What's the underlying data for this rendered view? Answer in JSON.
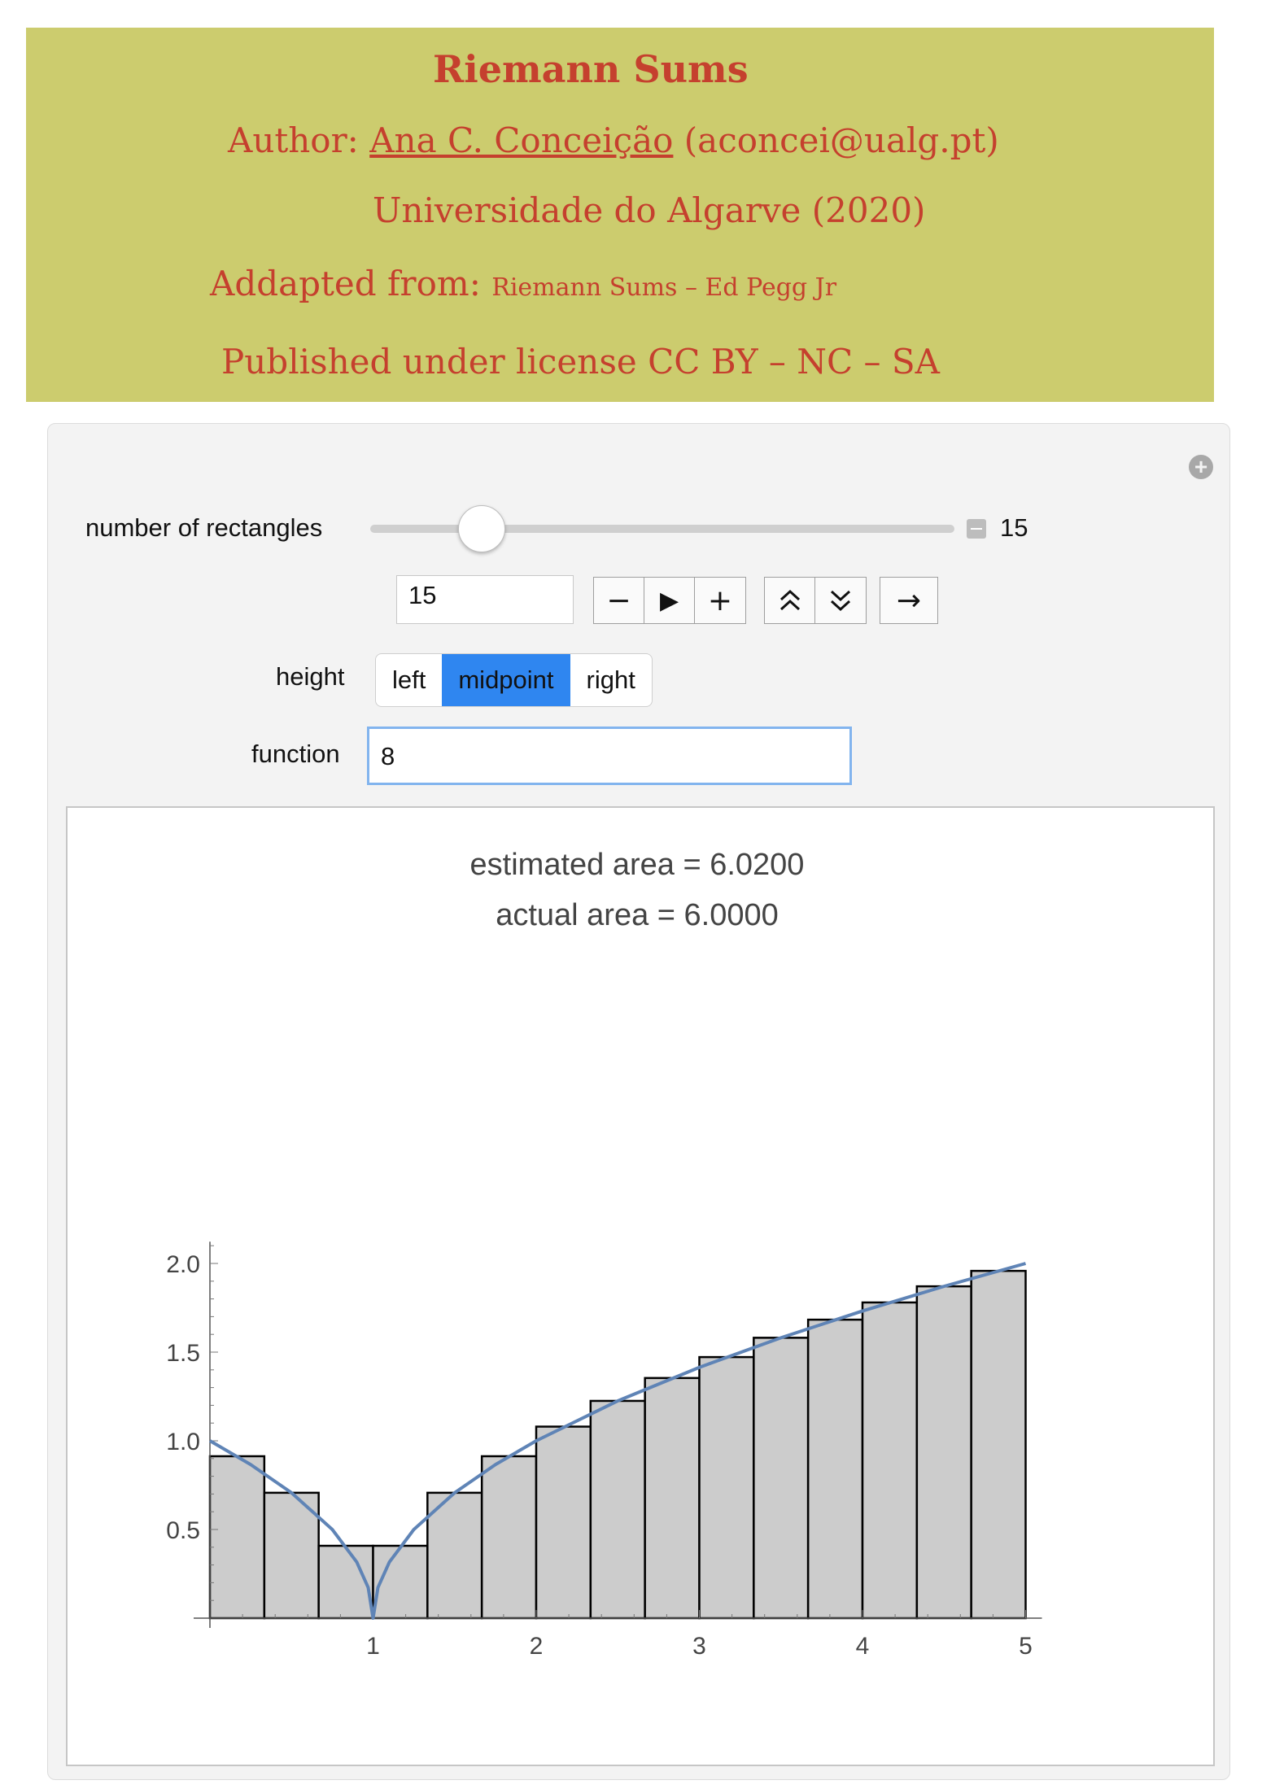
{
  "banner": {
    "title": "Riemann Sums",
    "author_prefix": "Author:",
    "author_name": "Ana C. Conceição",
    "author_email": "(aconcei@ualg.pt)",
    "university": "Universidade do Algarve (2020)",
    "adapted_prefix": "Addapted from:",
    "adapted_source": "Riemann Sums – Ed Pegg Jr",
    "license": "Published under license CC BY – NC – SA",
    "colors": {
      "background": "#cccc6e",
      "text": "#c5402e"
    }
  },
  "controls": {
    "rectangles_label": "number of rectangles",
    "rectangles_value": "15",
    "rectangles_slider_fraction": 0.19,
    "input_value": "15",
    "buttons": {
      "minus": "−",
      "play": "▶",
      "plus": "+",
      "faster": "⌃",
      "slower": "⌄",
      "direction": "→"
    },
    "height_label": "height",
    "height_options": [
      "left",
      "midpoint",
      "right"
    ],
    "height_selected": "midpoint",
    "function_label": "function",
    "function_value": "8",
    "icons": {
      "expand": "plus-circle-icon"
    }
  },
  "plot": {
    "estimated_area_text": "estimated area = 6.0200",
    "actual_area_text": "actual area = 6.0000"
  },
  "chart_data": {
    "type": "bar",
    "xlim": [
      0,
      5
    ],
    "ylim": [
      0,
      2.1
    ],
    "xticks": [
      1,
      2,
      3,
      4,
      5
    ],
    "yticks": [
      0.5,
      1.0,
      1.5,
      2.0
    ],
    "xtick_labels": [
      "1",
      "2",
      "3",
      "4",
      "5"
    ],
    "ytick_labels": [
      "0.5",
      "1.0",
      "1.5",
      "2.0"
    ],
    "rectangles": {
      "x_left": [
        0,
        0.3333,
        0.6667,
        1.0,
        1.3333,
        1.6667,
        2.0,
        2.3333,
        2.6667,
        3.0,
        3.3333,
        3.6667,
        4.0,
        4.3333,
        4.6667
      ],
      "width": 0.3333,
      "heights": [
        0.913,
        0.707,
        0.408,
        0.408,
        0.707,
        0.913,
        1.08,
        1.225,
        1.354,
        1.472,
        1.581,
        1.683,
        1.78,
        1.871,
        1.958
      ]
    },
    "curve": {
      "name": "sqrt(|x-1|)",
      "x": [
        0,
        0.25,
        0.5,
        0.75,
        0.9,
        0.97,
        1.0,
        1.03,
        1.1,
        1.25,
        1.5,
        1.75,
        2,
        2.5,
        3,
        3.5,
        4,
        4.5,
        5
      ],
      "y": [
        1.0,
        0.866,
        0.707,
        0.5,
        0.316,
        0.173,
        0.0,
        0.173,
        0.316,
        0.5,
        0.707,
        0.866,
        1.0,
        1.225,
        1.414,
        1.581,
        1.732,
        1.871,
        2.0
      ]
    },
    "grid": false,
    "colors": {
      "bar_fill": "#cccccc",
      "bar_stroke": "#000000",
      "curve": "#5f84b6"
    }
  }
}
